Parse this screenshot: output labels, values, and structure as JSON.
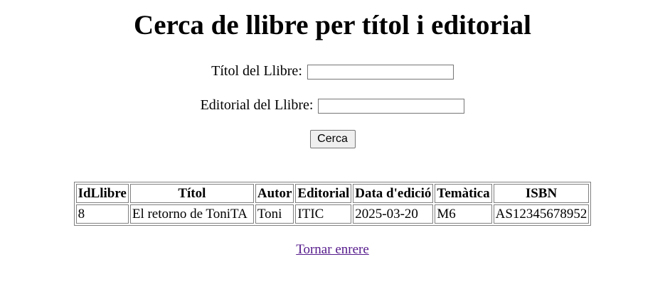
{
  "page": {
    "title": "Cerca de llibre per títol i editorial"
  },
  "form": {
    "titol_label": "Títol del Llibre:",
    "titol_value": "",
    "editorial_label": "Editorial del Llibre:",
    "editorial_value": "",
    "submit_label": "Cerca"
  },
  "results": {
    "headers": [
      "IdLlibre",
      "Títol",
      "Autor",
      "Editorial",
      "Data d'edició",
      "Temàtica",
      "ISBN"
    ],
    "rows": [
      [
        "8",
        "El retorno de ToniTA",
        "Toni",
        "ITIC",
        "2025-03-20",
        "M6",
        "AS12345678952"
      ]
    ]
  },
  "footer": {
    "back_link": "Tornar enrere"
  }
}
